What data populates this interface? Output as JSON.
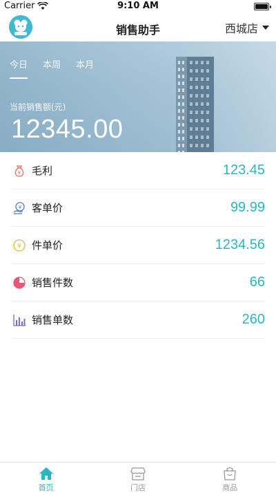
{
  "status_bar": {
    "carrier": "Carrier",
    "time": "9:10 AM",
    "battery_level": 1.0
  },
  "nav": {
    "title": "销售助手",
    "store": "西城店",
    "logo_icon": "mascot-logo-icon"
  },
  "hero": {
    "tabs": [
      {
        "label": "今日",
        "active": true
      },
      {
        "label": "本周",
        "active": false
      },
      {
        "label": "本月",
        "active": false
      }
    ],
    "sales_label": "当前销售额(元)",
    "sales_value": "12345.00"
  },
  "metrics": [
    {
      "label": "毛利",
      "value": "123.45",
      "icon": "money-bag-icon",
      "color": "#e96b5a"
    },
    {
      "label": "客单价",
      "value": "99.99",
      "icon": "customer-price-icon",
      "color": "#4a7fd4"
    },
    {
      "label": "件单价",
      "value": "1234.56",
      "icon": "coin-icon",
      "color": "#e9b43c"
    },
    {
      "label": "销售件数",
      "value": "66",
      "icon": "pie-chart-icon",
      "color": "#e8577a"
    },
    {
      "label": "销售单数",
      "value": "260",
      "icon": "bar-chart-icon",
      "color": "#7b6ad6"
    }
  ],
  "tab_bar": {
    "items": [
      {
        "label": "首页",
        "icon": "home-icon",
        "active": true
      },
      {
        "label": "门店",
        "icon": "store-icon",
        "active": false
      },
      {
        "label": "商品",
        "icon": "shopping-bag-icon",
        "active": false
      }
    ]
  },
  "colors": {
    "accent": "#2bb6c4",
    "hero_bg": "#9cbdd2",
    "inactive_tab": "#999999"
  }
}
